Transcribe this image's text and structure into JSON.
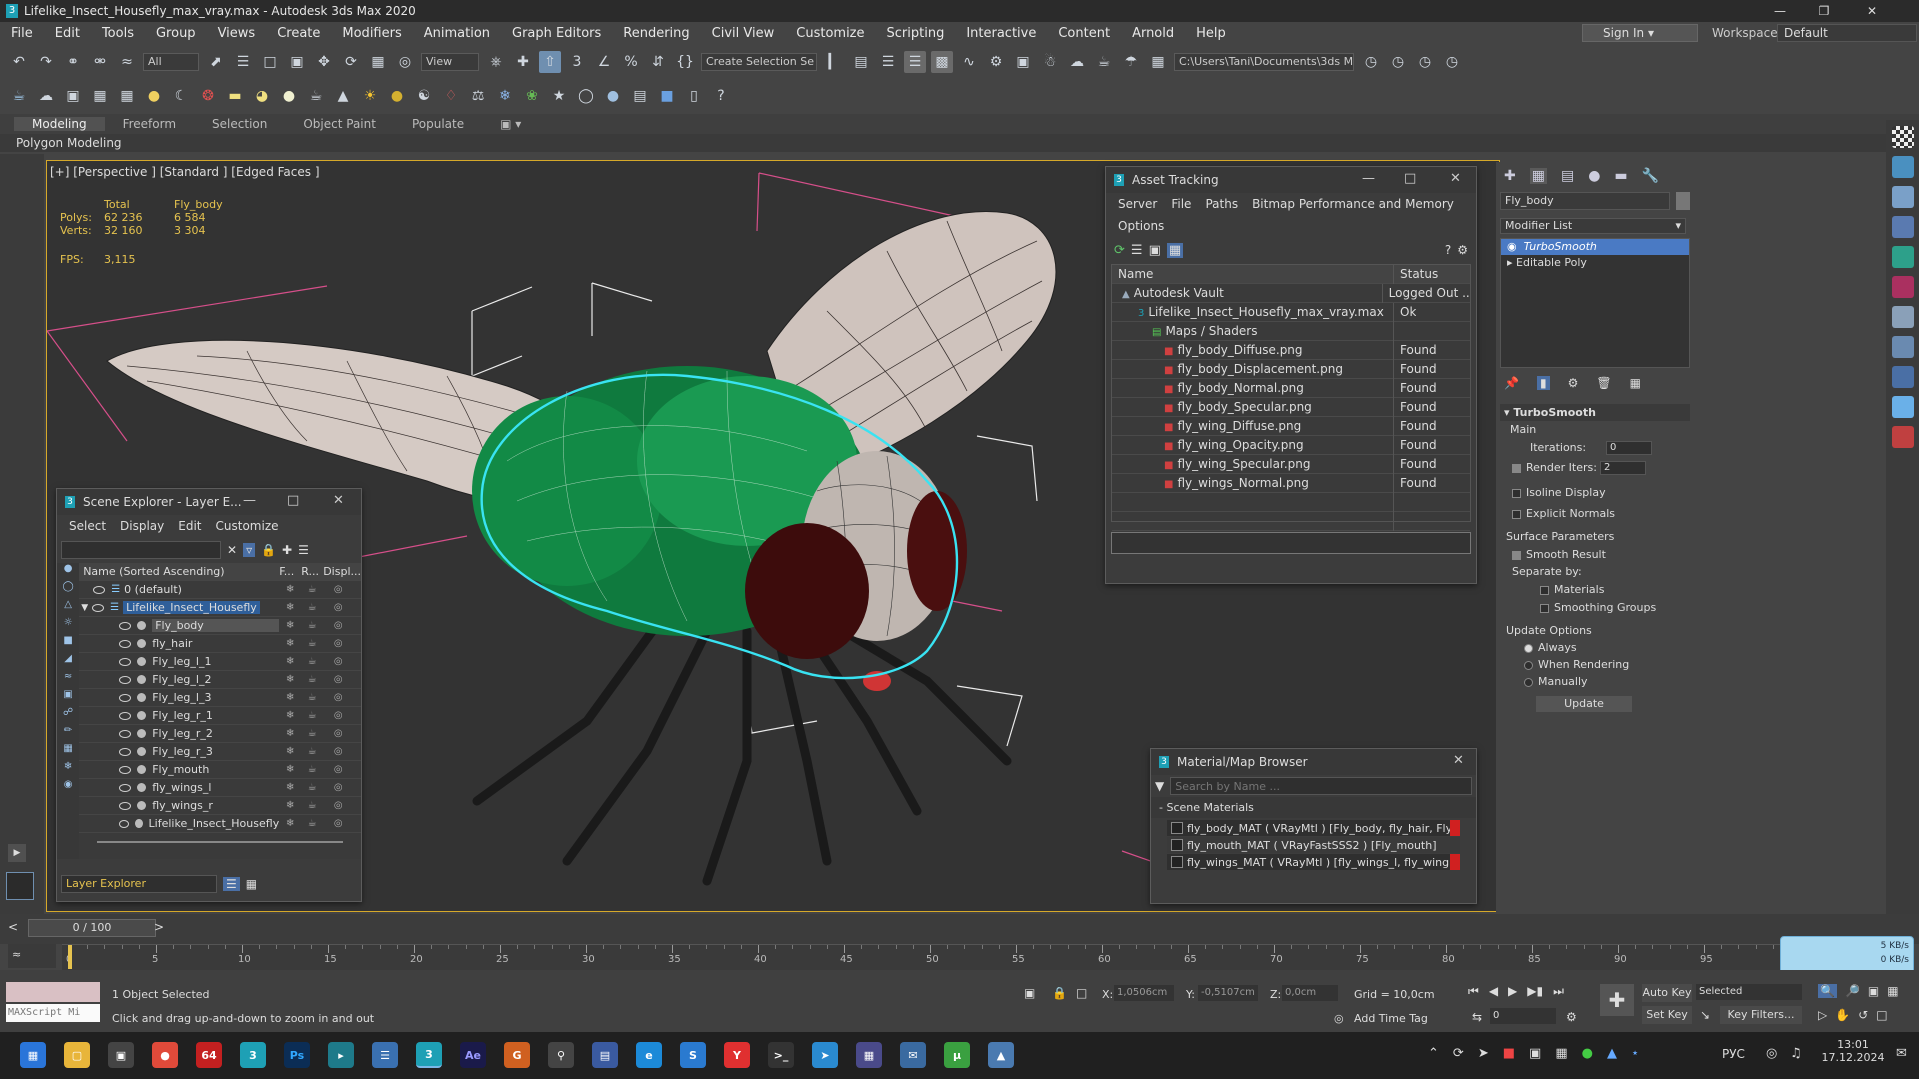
{
  "app": {
    "title": "Lifelike_Insect_Housefly_max_vray.max - Autodesk 3ds Max 2020",
    "sign_in": "Sign In",
    "workspaces_label": "Workspaces:",
    "workspace": "Default"
  },
  "menu": [
    "File",
    "Edit",
    "Tools",
    "Group",
    "Views",
    "Create",
    "Modifiers",
    "Animation",
    "Graph Editors",
    "Rendering",
    "Civil View",
    "Customize",
    "Scripting",
    "Interactive",
    "Content",
    "Arnold",
    "Help"
  ],
  "toolbar1": {
    "selection_filter": "All",
    "ref_coord": "View",
    "named_selection": "Create Selection Se",
    "project_path": "C:\\Users\\Tani\\Documents\\3ds Max 2020"
  },
  "ribbon": {
    "tabs": [
      "Modeling",
      "Freeform",
      "Selection",
      "Object Paint",
      "Populate"
    ],
    "active": "Modeling",
    "sub": "Polygon Modeling"
  },
  "viewport": {
    "label": "[+] [Perspective ] [Standard ] [Edged Faces ]",
    "stats": {
      "col_total": "Total",
      "col_obj": "Fly_body",
      "polys_label": "Polys:",
      "polys_total": "62 236",
      "polys_obj": "6 584",
      "verts_label": "Verts:",
      "verts_total": "32 160",
      "verts_obj": "3 304",
      "fps_label": "FPS:",
      "fps": "3,115"
    }
  },
  "asset_tracking": {
    "title": "Asset Tracking",
    "menu": [
      "Server",
      "File",
      "Paths",
      "Bitmap Performance and Memory"
    ],
    "menu2": "Options",
    "col_name": "Name",
    "col_status": "Status",
    "rows": [
      {
        "name": "Autodesk Vault",
        "status": "Logged Out ...",
        "indent": 1
      },
      {
        "name": "Lifelike_Insect_Housefly_max_vray.max",
        "status": "Ok",
        "indent": 2
      },
      {
        "name": "Maps / Shaders",
        "status": "",
        "indent": 3
      },
      {
        "name": "fly_body_Diffuse.png",
        "status": "Found",
        "indent": 4
      },
      {
        "name": "fly_body_Displacement.png",
        "status": "Found",
        "indent": 4
      },
      {
        "name": "fly_body_Normal.png",
        "status": "Found",
        "indent": 4
      },
      {
        "name": "fly_body_Specular.png",
        "status": "Found",
        "indent": 4
      },
      {
        "name": "fly_wing_Diffuse.png",
        "status": "Found",
        "indent": 4
      },
      {
        "name": "fly_wing_Opacity.png",
        "status": "Found",
        "indent": 4
      },
      {
        "name": "fly_wing_Specular.png",
        "status": "Found",
        "indent": 4
      },
      {
        "name": "fly_wings_Normal.png",
        "status": "Found",
        "indent": 4
      }
    ]
  },
  "scene_explorer": {
    "title": "Scene Explorer - Layer E...",
    "menu": [
      "Select",
      "Display",
      "Edit",
      "Customize"
    ],
    "col_name": "Name (Sorted Ascending)",
    "col_f": "F...",
    "col_r": "R...",
    "col_d": "Displ...",
    "rows": [
      {
        "name": "0 (default)",
        "level": 0
      },
      {
        "name": "Lifelike_Insect_Housefly",
        "level": 0
      },
      {
        "name": "Fly_body",
        "level": 1
      },
      {
        "name": "fly_hair",
        "level": 1
      },
      {
        "name": "Fly_leg_l_1",
        "level": 1
      },
      {
        "name": "Fly_leg_l_2",
        "level": 1
      },
      {
        "name": "Fly_leg_l_3",
        "level": 1
      },
      {
        "name": "Fly_leg_r_1",
        "level": 1
      },
      {
        "name": "Fly_leg_r_2",
        "level": 1
      },
      {
        "name": "Fly_leg_r_3",
        "level": 1
      },
      {
        "name": "Fly_mouth",
        "level": 1
      },
      {
        "name": "fly_wings_l",
        "level": 1
      },
      {
        "name": "fly_wings_r",
        "level": 1
      },
      {
        "name": "Lifelike_Insect_Housefly",
        "level": 1
      }
    ],
    "footer": "Layer Explorer"
  },
  "material_browser": {
    "title": "Material/Map Browser",
    "search_placeholder": "Search by Name ...",
    "section": "- Scene Materials",
    "items": [
      "fly_body_MAT ( VRayMtl ) [Fly_body, fly_hair, Fly...",
      "fly_mouth_MAT ( VRayFastSSS2 ) [Fly_mouth]",
      "fly_wings_MAT ( VRayMtl ) [fly_wings_l, fly_wing..."
    ]
  },
  "command_panel": {
    "object_name": "Fly_body",
    "modifier_list": "Modifier List",
    "stack": [
      "TurboSmooth",
      "Editable Poly"
    ],
    "rollout_title": "TurboSmooth",
    "main_label": "Main",
    "iterations_label": "Iterations:",
    "iterations": "0",
    "render_iters_label": "Render Iters:",
    "render_iters": "2",
    "isoline": "Isoline Display",
    "explicit": "Explicit Normals",
    "surface_params": "Surface Parameters",
    "smooth_result": "Smooth Result",
    "separate_by": "Separate by:",
    "materials": "Materials",
    "smoothing_groups": "Smoothing Groups",
    "update_options": "Update Options",
    "always": "Always",
    "when_rendering": "When Rendering",
    "manually": "Manually",
    "update_btn": "Update"
  },
  "timeline": {
    "frame": "0 / 100",
    "ticks": [
      "0",
      "5",
      "10",
      "15",
      "20",
      "25",
      "30",
      "35",
      "40",
      "45",
      "50",
      "55",
      "60",
      "65",
      "70",
      "75",
      "80",
      "85",
      "90",
      "95"
    ]
  },
  "status": {
    "maxscript": "MAXScript Mi",
    "selected": "1 Object Selected",
    "hint": "Click and drag up-and-down to zoom in and out",
    "x_label": "X:",
    "x": "1,0506cm",
    "y_label": "Y:",
    "y": "-0,5107cm",
    "z_label": "Z:",
    "z": "0,0cm",
    "grid": "Grid = 10,0cm",
    "add_time_tag": "Add Time Tag",
    "auto_key": "Auto Key",
    "set_key": "Set Key",
    "key_mode": "Selected",
    "key_filters": "Key Filters...",
    "frame_field": "0",
    "net_speed": "5 KB/s",
    "net_speed2": "0 KB/s"
  },
  "taskbar": {
    "lang": "РУС",
    "time": "13:01",
    "date": "17.12.2024"
  }
}
